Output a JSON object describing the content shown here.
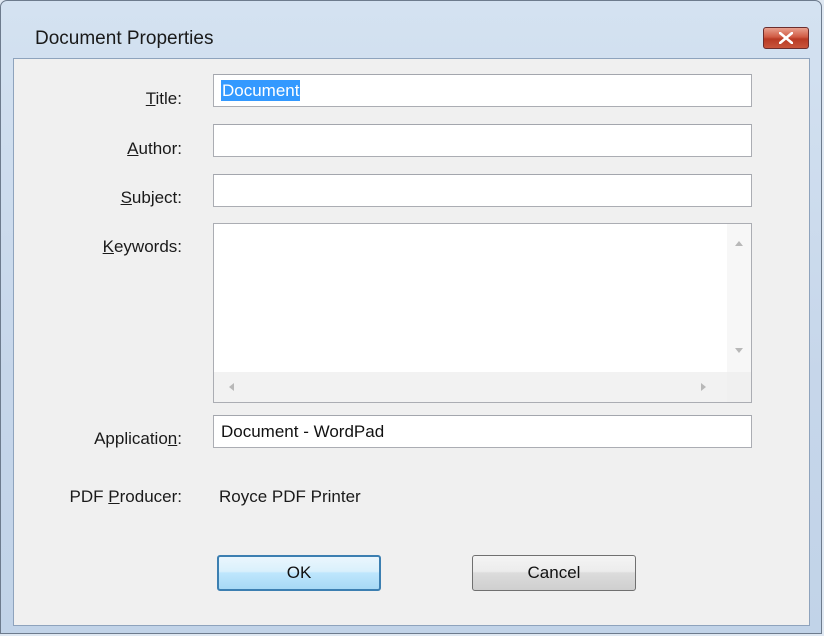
{
  "window": {
    "title": "Document Properties"
  },
  "fields": {
    "title": {
      "label_pre": "",
      "label_u": "T",
      "label_post": "itle:",
      "value": "Document"
    },
    "author": {
      "label_pre": "",
      "label_u": "A",
      "label_post": "uthor:",
      "value": ""
    },
    "subject": {
      "label_pre": "",
      "label_u": "S",
      "label_post": "ubject:",
      "value": ""
    },
    "keywords": {
      "label_pre": "",
      "label_u": "K",
      "label_post": "eywords:",
      "value": ""
    },
    "application": {
      "label_pre": "Applicatio",
      "label_u": "n",
      "label_post": ":",
      "value": "Document - WordPad"
    },
    "pdf_producer": {
      "label_pre": "PDF ",
      "label_u": "P",
      "label_post": "roducer:",
      "value": "Royce PDF Printer"
    }
  },
  "buttons": {
    "ok": "OK",
    "cancel": "Cancel"
  },
  "colors": {
    "selection": "#3399ff",
    "close_button": "#c9553c",
    "default_button_border": "#3c7fb1"
  }
}
